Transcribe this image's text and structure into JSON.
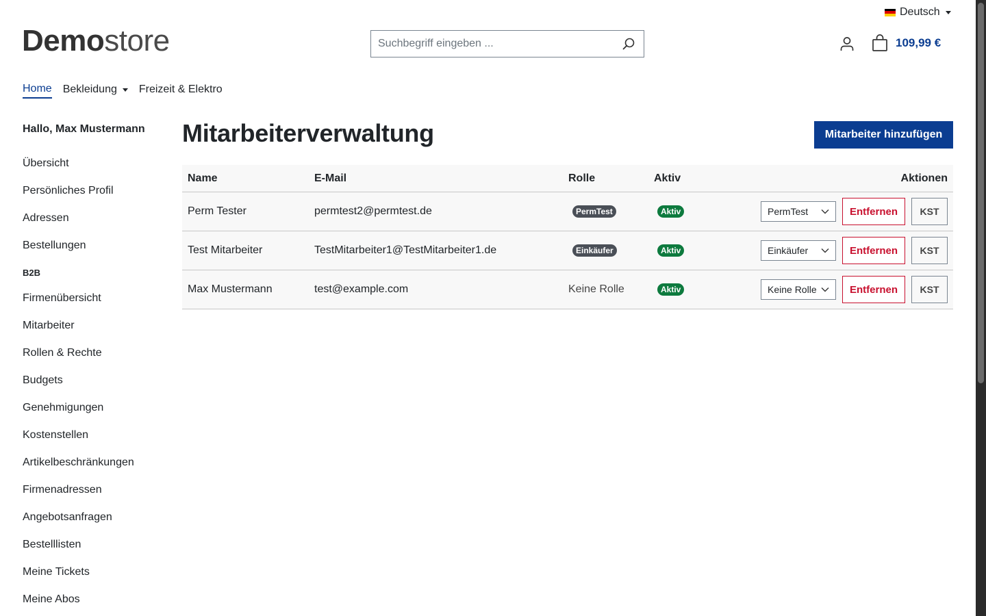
{
  "language": {
    "label": "Deutsch",
    "flag_colors": [
      "#000000",
      "#dd0000",
      "#ffce00"
    ]
  },
  "logo": {
    "bold": "Demo",
    "regular": "store"
  },
  "search": {
    "placeholder": "Suchbegriff eingeben ..."
  },
  "cart": {
    "total": "109,99 €"
  },
  "nav": {
    "home": "Home",
    "bekleidung": "Bekleidung",
    "freizeit": "Freizeit & Elektro"
  },
  "sidebar": {
    "greeting": "Hallo, Max Mustermann",
    "items_top": [
      "Übersicht",
      "Persönliches Profil",
      "Adressen",
      "Bestellungen"
    ],
    "b2b_heading": "B2B",
    "items_b2b": [
      "Firmenübersicht",
      "Mitarbeiter",
      "Rollen & Rechte",
      "Budgets",
      "Genehmigungen",
      "Kostenstellen",
      "Artikelbeschränkungen",
      "Firmenadressen",
      "Angebotsanfragen",
      "Bestelllisten",
      "Meine Tickets",
      "Meine Abos"
    ]
  },
  "page": {
    "title": "Mitarbeiterverwaltung",
    "add_button": "Mitarbeiter hinzufügen"
  },
  "table": {
    "headers": {
      "name": "Name",
      "email": "E-Mail",
      "role": "Rolle",
      "active": "Aktiv",
      "actions": "Aktionen"
    },
    "rows": [
      {
        "name": "Perm Tester",
        "email": "permtest2@permtest.de",
        "role": "PermTest",
        "role_badge": true,
        "active": "Aktiv",
        "select": "PermTest",
        "remove": "Entfernen",
        "kst": "KST"
      },
      {
        "name": "Test Mitarbeiter",
        "email": "TestMitarbeiter1@TestMitarbeiter1.de",
        "role": "Einkäufer",
        "role_badge": true,
        "active": "Aktiv",
        "select": "Einkäufer",
        "remove": "Entfernen",
        "kst": "KST"
      },
      {
        "name": "Max Mustermann",
        "email": "test@example.com",
        "role": "Keine Rolle",
        "role_badge": false,
        "active": "Aktiv",
        "select": "Keine Rolle",
        "remove": "Entfernen",
        "kst": "KST"
      }
    ]
  },
  "colors": {
    "primary": "#0b3d91",
    "danger": "#c8102e",
    "success": "#0d7a3e",
    "badge_dark": "#4a4f57"
  }
}
